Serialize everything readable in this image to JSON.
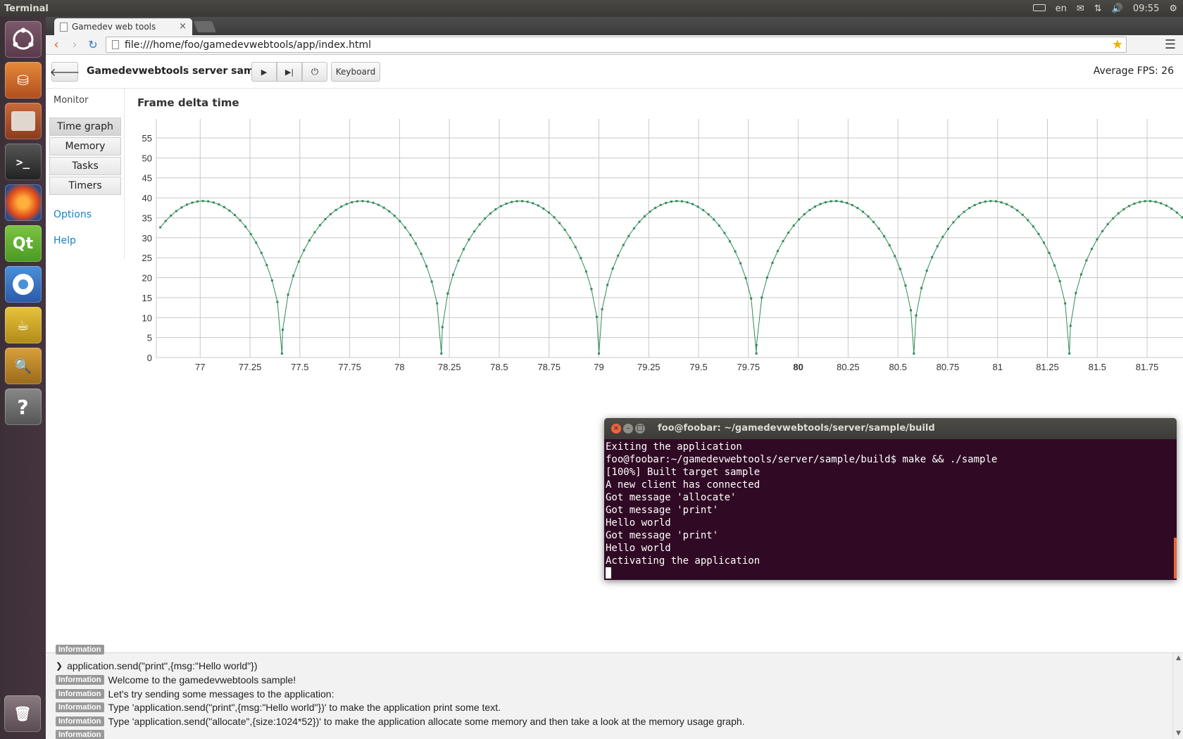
{
  "top_panel": {
    "app_title": "Terminal",
    "keyboard_layout": "en",
    "clock": "09:55"
  },
  "browser": {
    "tab_title": "Gamedev web tools",
    "tab_close": "×",
    "url": "file:///home/foo/gamedevwebtools/app/index.html"
  },
  "app": {
    "title": "Gamedevwebtools server sample",
    "keyboard_label": "Keyboard",
    "fps_label": "Average FPS: 26"
  },
  "sidebar": {
    "header": "Monitor",
    "items": [
      {
        "label": "Time graph",
        "active": true
      },
      {
        "label": "Memory"
      },
      {
        "label": "Tasks"
      },
      {
        "label": "Timers"
      }
    ],
    "links": [
      {
        "label": "Options"
      },
      {
        "label": "Help"
      }
    ]
  },
  "graph_title": "Frame delta time",
  "chart_data": {
    "type": "line",
    "title": "Frame delta time",
    "xlabel": "",
    "ylabel": "",
    "xlim": [
      76.78,
      81.93
    ],
    "ylim": [
      0,
      58
    ],
    "x_ticks": [
      "77",
      "77.25",
      "77.5",
      "77.75",
      "78",
      "78.25",
      "78.5",
      "78.75",
      "79",
      "79.25",
      "79.5",
      "79.75",
      "80",
      "80.25",
      "80.5",
      "80.75",
      "81",
      "81.25",
      "81.5",
      "81.75"
    ],
    "y_ticks": [
      "0",
      "5",
      "10",
      "15",
      "20",
      "25",
      "30",
      "35",
      "40",
      "45",
      "50",
      "55"
    ],
    "color": "#2e8b57",
    "grid": true,
    "series": [
      {
        "description_values": "periodic arches peaking ~39 and dropping to ~1",
        "minima_x": [
          77.41,
          78.21,
          79.0,
          79.79,
          80.58,
          81.36
        ],
        "peak_value": 39.2,
        "min_value": 1,
        "start_value": 30
      }
    ]
  },
  "terminal": {
    "title": "foo@foobar: ~/gamedevwebtools/server/sample/build",
    "lines": [
      "Exiting the application",
      "foo@foobar:~/gamedevwebtools/server/sample/build$ make && ./sample",
      "[100%] Built target sample",
      "A new client has connected",
      "Got message 'allocate'",
      "Got message 'print'",
      "Hello world",
      "Got message 'print'",
      "Hello world",
      "Activating the application"
    ]
  },
  "console": {
    "badge_label": "Information",
    "command_line": "application.send(\"print\",{msg:\"Hello world\"})",
    "messages": [
      "Welcome to the gamedevwebtools sample!",
      "Let's try sending some messages to the application:",
      "Type 'application.send(\"print\",{msg:\"Hello world\"})' to make the application print some text.",
      "Type 'application.send(\"allocate\",{size:1024*52})' to make the application allocate some memory and then take a look at the memory usage graph.",
      ""
    ]
  }
}
